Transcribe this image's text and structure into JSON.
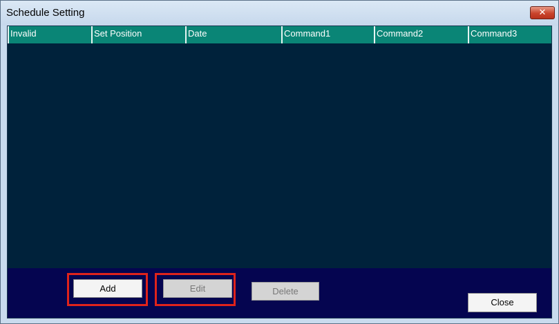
{
  "window": {
    "title": "Schedule Setting",
    "close_glyph": "✕"
  },
  "table": {
    "columns": [
      {
        "label": "Invalid"
      },
      {
        "label": "Set Position"
      },
      {
        "label": "Date"
      },
      {
        "label": "Command1"
      },
      {
        "label": "Command2"
      },
      {
        "label": "Command3"
      }
    ],
    "rows": []
  },
  "buttons": {
    "add": "Add",
    "edit": "Edit",
    "delete": "Delete",
    "close": "Close"
  },
  "state": {
    "edit_enabled": false,
    "delete_enabled": false
  },
  "colors": {
    "header": "#0a8576",
    "list_background": "#00223b",
    "footer": "#050550",
    "highlight": "#e0231b"
  }
}
